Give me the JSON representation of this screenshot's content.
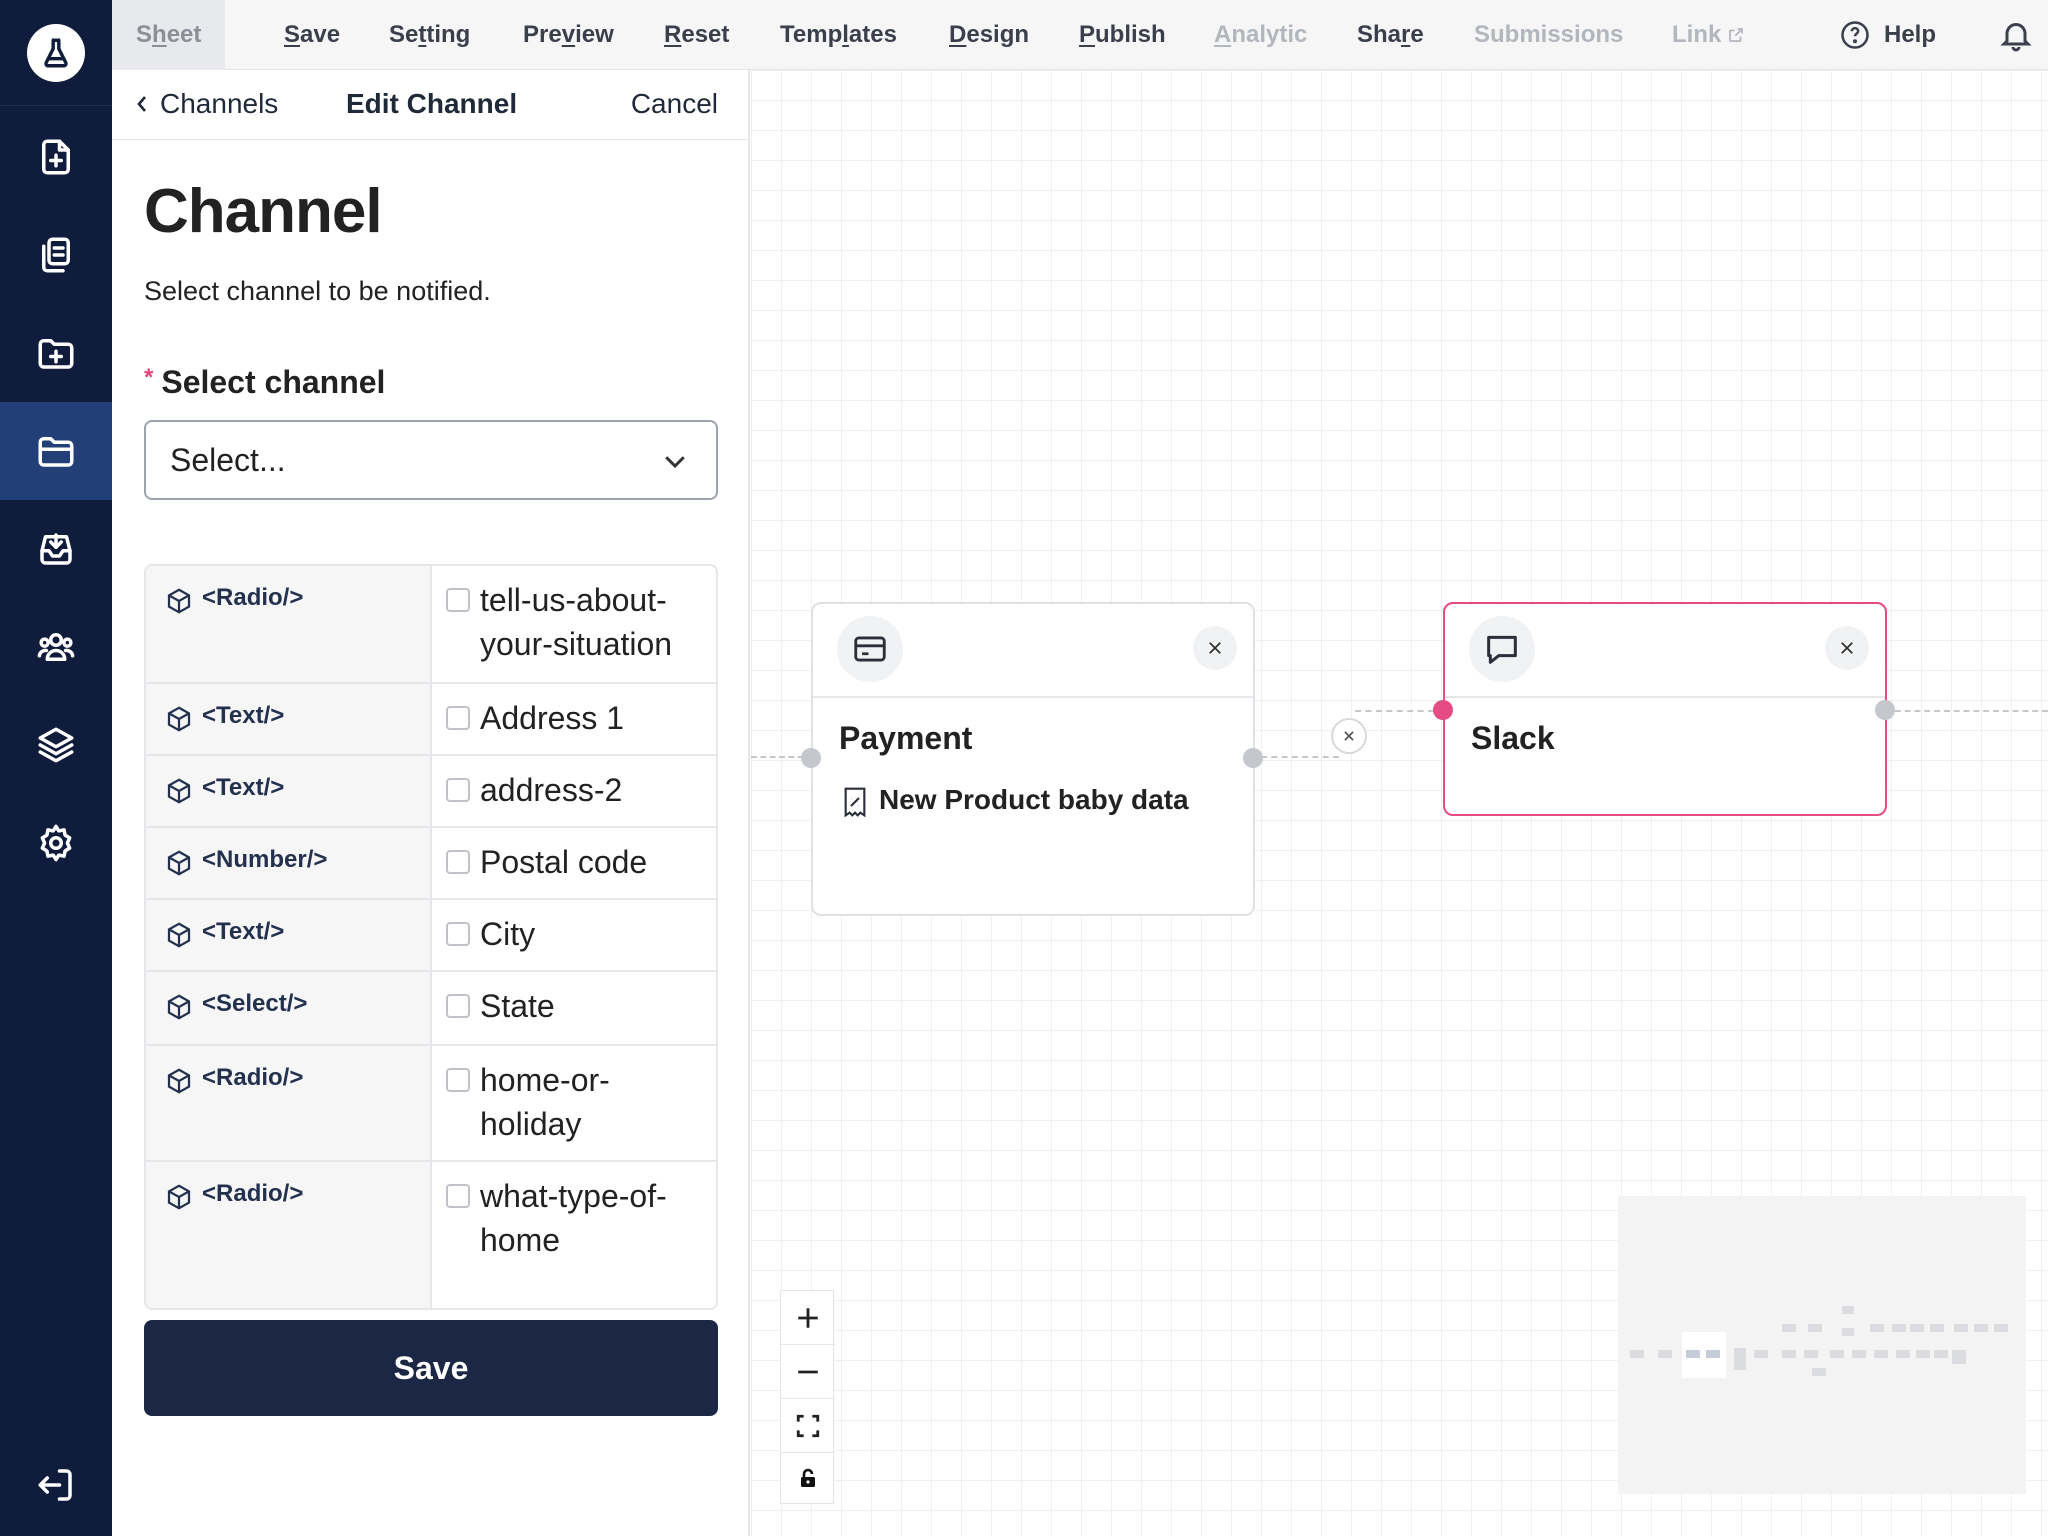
{
  "topbar": {
    "tabs": [
      {
        "label": "Sheet",
        "accel": "h",
        "state": "active"
      },
      {
        "label": "Save",
        "accel": "S"
      },
      {
        "label": "Setting",
        "accel": "t"
      },
      {
        "label": "Preview",
        "accel": "v"
      },
      {
        "label": "Reset",
        "accel": "R"
      },
      {
        "label": "Templates",
        "accel": "l"
      },
      {
        "label": "Design",
        "accel": "D"
      },
      {
        "label": "Publish",
        "accel": "P"
      },
      {
        "label": "Analytic",
        "accel": "A",
        "state": "muted"
      },
      {
        "label": "Share",
        "accel": "r"
      },
      {
        "label": "Submissions",
        "state": "muted"
      },
      {
        "label": "Link",
        "state": "muted"
      }
    ],
    "help_label": "Help"
  },
  "panel": {
    "back_label": "Channels",
    "title": "Edit Channel",
    "cancel_label": "Cancel",
    "heading": "Channel",
    "description": "Select channel to be notified.",
    "field_label": "Select channel",
    "required_mark": "*",
    "select_placeholder": "Select...",
    "rows": [
      {
        "type": "<Radio/>",
        "name": "tell-us-about-your-situation"
      },
      {
        "type": "<Text/>",
        "name": "Address 1"
      },
      {
        "type": "<Text/>",
        "name": "address-2"
      },
      {
        "type": "<Number/>",
        "name": "Postal code"
      },
      {
        "type": "<Text/>",
        "name": "City"
      },
      {
        "type": "<Select/>",
        "name": "State"
      },
      {
        "type": "<Radio/>",
        "name": "home-or-holiday"
      },
      {
        "type": "<Radio/>",
        "name": "what-type-of-home"
      }
    ],
    "save_label": "Save"
  },
  "canvas": {
    "payment_node": {
      "title": "Payment",
      "subtitle": "New Product baby data",
      "icon": "credit-card-icon"
    },
    "slack_node": {
      "title": "Slack",
      "icon": "chat-bubble-icon",
      "border_color": "#e64c83"
    }
  },
  "colors": {
    "rail": "#0f1c3b",
    "rail_active": "#233f78",
    "primary_button": "#1b2744",
    "accent_pink": "#e64c83"
  }
}
